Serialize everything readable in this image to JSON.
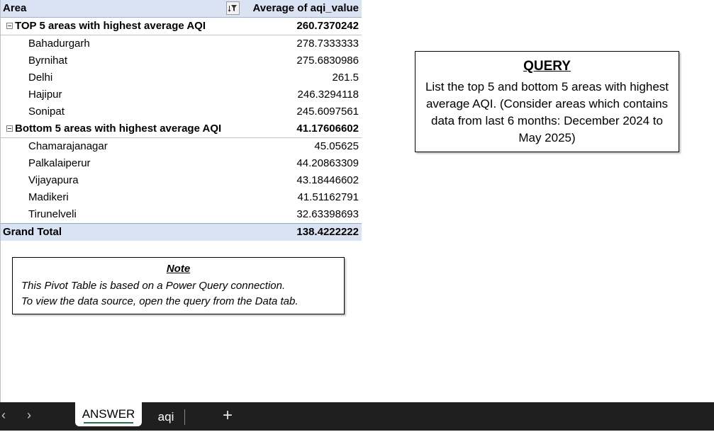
{
  "pivot": {
    "header": {
      "row_label": "Area",
      "value_label": "Average of aqi_value"
    },
    "groups": [
      {
        "label": "TOP 5 areas with highest average AQI",
        "value": "260.7370242",
        "rows": [
          {
            "label": "Bahadurgarh",
            "value": "278.7333333"
          },
          {
            "label": "Byrnihat",
            "value": "275.6830986"
          },
          {
            "label": "Delhi",
            "value": "261.5"
          },
          {
            "label": "Hajipur",
            "value": "246.3294118"
          },
          {
            "label": "Sonipat",
            "value": "245.6097561"
          }
        ]
      },
      {
        "label": "Bottom 5 areas with highest average AQI",
        "value": "41.17606602",
        "rows": [
          {
            "label": "Chamarajanagar",
            "value": "45.05625"
          },
          {
            "label": "Palkalaiperur",
            "value": "44.20863309"
          },
          {
            "label": "Vijayapura",
            "value": "43.18446602"
          },
          {
            "label": "Madikeri",
            "value": "41.51162791"
          },
          {
            "label": "Tirunelveli",
            "value": "32.63398693"
          }
        ]
      }
    ],
    "grand_total": {
      "label": "Grand Total",
      "value": "138.4222222"
    }
  },
  "note": {
    "title": "Note",
    "line1": "This Pivot Table is based on a Power Query connection.",
    "line2": "To view the data source, open the query from the Data tab."
  },
  "query": {
    "title": "QUERY",
    "text": "List the top 5 and bottom 5 areas with highest average AQI. (Consider areas which contains data from last 6 months: December 2024 to May 2025)"
  },
  "sheets": {
    "prev_glyph": "‹",
    "next_glyph": "›",
    "active": "ANSWER",
    "other": "aqi",
    "add_glyph": "+"
  },
  "colors": {
    "header_fill": "#dae3f3",
    "sheetbar": "#1f1f1f",
    "active_tab_underline": "#217346"
  },
  "icons": [
    "filter-sort-icon",
    "collapse-icon",
    "prev-sheet-icon",
    "next-sheet-icon",
    "add-sheet-icon"
  ]
}
